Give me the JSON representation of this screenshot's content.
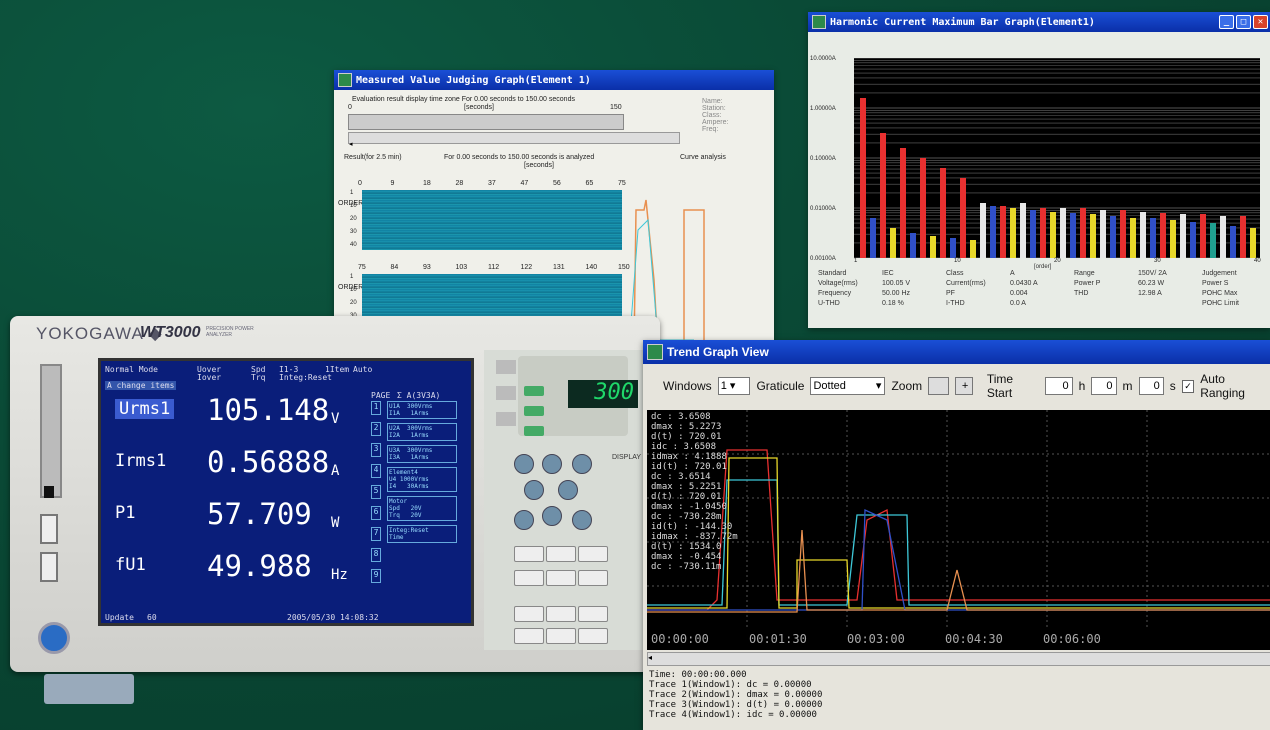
{
  "colors": {
    "background": "#0a4a36",
    "screen": "#0a1e7a",
    "titlebar": "#0a2fa8",
    "trace_cyan": "#3ec8d8",
    "trace_red": "#e83030",
    "trace_yellow": "#e8d82a",
    "trace_blue": "#3050c8"
  },
  "instrument": {
    "brand": "YOKOGAWA ◆",
    "model": "WT3000",
    "subtitle": "PRECISION POWER ANALYZER",
    "screen": {
      "mode": "Normal Mode",
      "header_mid1": "Uover",
      "header_mid2": "Iover",
      "header_spd": "Spd",
      "header_trq": "Trq",
      "header_range": "I1-3",
      "header_integ": "Integ:Reset",
      "header_1sample": "1Item",
      "header_auto": "Auto",
      "change_items": "A  change items",
      "measurements": [
        {
          "label": "Urms1",
          "value": "105.148",
          "unit": "V"
        },
        {
          "label": "Irms1",
          "value": "0.56888",
          "unit": "A"
        },
        {
          "label": "P1",
          "value": "57.709",
          "unit": "W"
        },
        {
          "label": "fU1",
          "value": "49.988",
          "unit": "Hz"
        }
      ],
      "page_label": "PAGE",
      "page_head": "Σ A(3V3A)",
      "page_items": [
        "U1A  300Vrms\nI1A   1Arms",
        "U2A  300Vrms\nI2A   1Arms",
        "U3A  300Vrms\nI3A   1Arms",
        "Element4\nU4 1000Vrms\nI4   30Arms",
        "Motor\nSpd   20V\nTrq   20V",
        "Integ:Reset\nTime"
      ],
      "page_numbers": [
        "1",
        "2",
        "3",
        "4",
        "5",
        "6",
        "7",
        "8",
        "9"
      ],
      "update_label": "Update",
      "update_value": "60",
      "timestamp": "2005/05/30 14:08:32"
    },
    "led_display": "300",
    "display_key": "DISPLAY"
  },
  "win1": {
    "title": "Measured Value Judging Graph(Element 1)",
    "eval_text": "Evaluation result display time zone  For   0.00 seconds to 150.00 seconds",
    "axis_start": "0",
    "axis_end": "150",
    "axis_unit": "[seconds]",
    "result_label": "Result(for 2.5 min)",
    "result_text": "For   0.00 seconds to 150.00 seconds  is analyzed",
    "result_unit": "[seconds]",
    "side_labels": [
      "Name:",
      "Station:",
      "Class:",
      "Ampere:",
      "Freq:"
    ],
    "curve_label": "Curve analysis",
    "top_ticks": [
      "0",
      "9",
      "18",
      "28",
      "37",
      "47",
      "56",
      "65",
      "75"
    ],
    "bot_ticks": [
      "75",
      "84",
      "93",
      "103",
      "112",
      "122",
      "131",
      "140",
      "150"
    ],
    "order_label": "ORDER",
    "y_ticks": [
      "1",
      "10",
      "20",
      "30",
      "40"
    ]
  },
  "win2": {
    "title": "Harmonic Current Maximum Bar Graph(Element1)",
    "y_ticks": [
      "10.0000A",
      "1.00000A",
      "0.10000A",
      "0.01000A",
      "0.00100A"
    ],
    "x_ticks": [
      "1",
      "10",
      "20",
      "30",
      "40"
    ],
    "x_unit": "[order]",
    "info_rows": [
      [
        "Standard",
        "IEC",
        "Class",
        "A",
        "Range",
        "150V/ 2A",
        "Judgement"
      ],
      [
        "Voltage(rms)",
        "100.05 V",
        "Current(rms)",
        "0.0430 A",
        "Power P",
        "60.23 W",
        "Power S"
      ],
      [
        "Frequency",
        "50.00 Hz",
        "PF",
        "0.004",
        "THD",
        "12.98 A",
        "POHC Max"
      ],
      [
        "U-THD",
        "0.18 %",
        "I-THD",
        "0.0 A",
        "",
        "",
        "POHC Limit"
      ]
    ]
  },
  "win3": {
    "title": "Trend Graph View",
    "windows_label": "Windows",
    "windows_value": "1",
    "graticule_label": "Graticule",
    "graticule_value": "Dotted",
    "zoom_label": "Zoom",
    "zoom_plus": "+",
    "time_start_label": "Time Start",
    "time_h": "0",
    "time_h_unit": "h",
    "time_m": "0",
    "time_m_unit": "m",
    "time_s": "0",
    "time_s_unit": "s",
    "auto_ranging_label": "Auto Ranging",
    "readouts": [
      "dc    : 3.6508",
      "dmax  : 5.2273",
      "d(t)  : 720.01",
      "idc   : 3.6508",
      "idmax : 4.1888",
      "id(t) : 720.01",
      "dc    : 3.6514",
      "dmax  : 5.2251",
      "d(t)  : 720.01",
      "dmax  : -1.0450",
      "dc    : -730.28m",
      "id(t) : -144.30",
      "idmax : -837.72m",
      "d(t)  : 1534.0",
      "dmax  : -0.454",
      "dc    : -730.11m"
    ],
    "time_ticks": [
      "00:00:00",
      "00:01:30",
      "00:03:00",
      "00:04:30",
      "00:06:00"
    ],
    "status_lines": [
      "Time: 00:00:00.000",
      "Trace 1(Window1): dc    = 0.00000",
      "Trace 2(Window1): dmax  = 0.00000",
      "Trace 3(Window1): d(t)  = 0.00000",
      "Trace 4(Window1): idc   = 0.00000"
    ]
  }
}
